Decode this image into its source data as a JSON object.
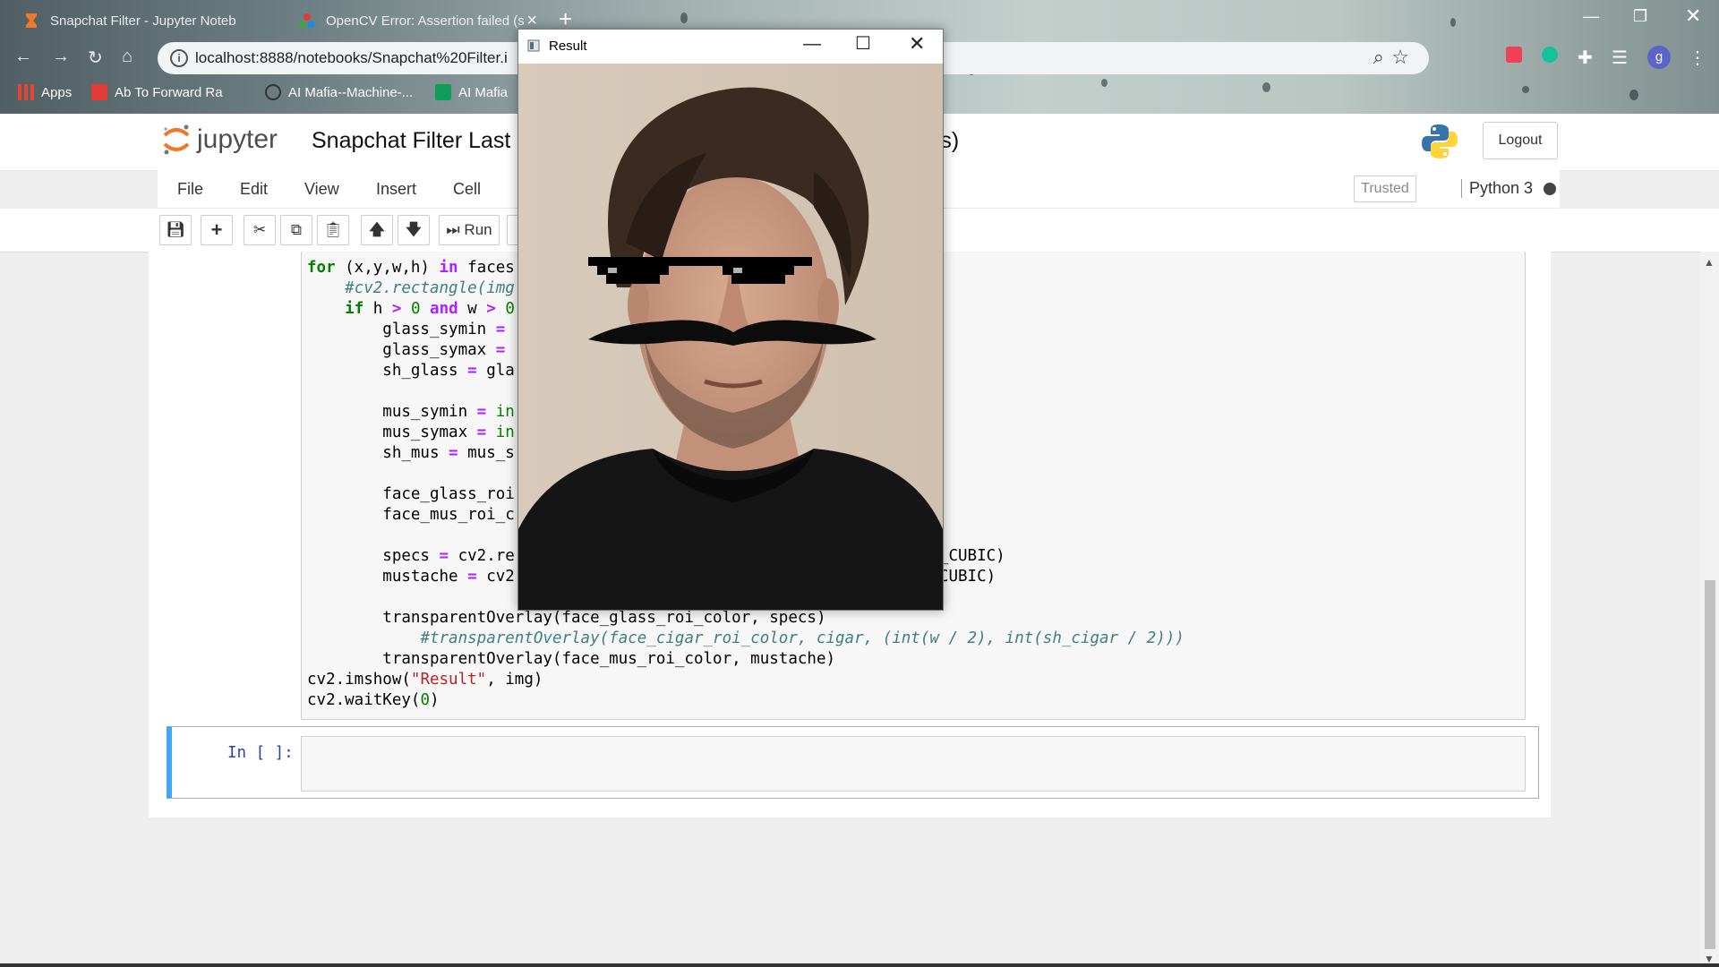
{
  "browser": {
    "tabs": [
      {
        "title": "Snapchat Filter - Jupyter Noteb",
        "active": true
      },
      {
        "title": "OpenCV Error: Assertion failed (s",
        "active": false
      }
    ],
    "address": "localhost:8888/notebooks/Snapchat%20Filter.i",
    "bookmarks": [
      {
        "label": "Apps"
      },
      {
        "label": "Ab To Forward Ra"
      },
      {
        "label": "AI Mafia--Machine-..."
      },
      {
        "label": "AI Mafia"
      }
    ],
    "profile_initial": "g"
  },
  "jupyter": {
    "logo_text": "jupyter",
    "title_left": "Snapchat Filter Last",
    "title_right": "s)",
    "logout_label": "Logout",
    "menu": [
      "File",
      "Edit",
      "View",
      "Insert",
      "Cell"
    ],
    "trusted_label": "Trusted",
    "kernel_label": "Python 3",
    "run_label": "Run"
  },
  "cell2": {
    "prompt": "In [ ]:"
  },
  "popup": {
    "title": "Result"
  },
  "colors": {
    "accent": "#42a5f5",
    "jupyter_orange": "#f37726",
    "prompt_blue": "#303f9f"
  }
}
